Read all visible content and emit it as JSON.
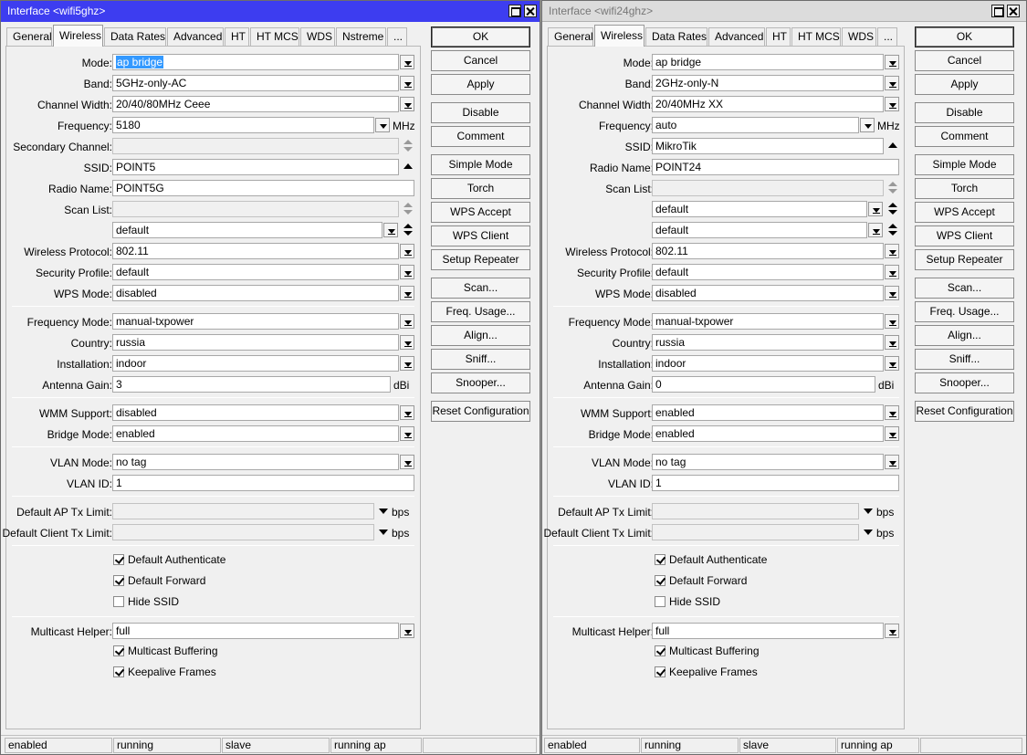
{
  "win1": {
    "title": "Interface <wifi5ghz>",
    "tabs": [
      "General",
      "Wireless",
      "Data Rates",
      "Advanced",
      "HT",
      "HT MCS",
      "WDS",
      "Nstreme",
      "..."
    ],
    "labels": {
      "mode": "Mode:",
      "band": "Band:",
      "channel_width": "Channel Width:",
      "frequency": "Frequency:",
      "secondary_channel": "Secondary Channel:",
      "ssid": "SSID:",
      "radio_name": "Radio Name:",
      "scan_list": "Scan List:",
      "wireless_protocol": "Wireless Protocol:",
      "security_profile": "Security Profile:",
      "wps_mode": "WPS Mode:",
      "frequency_mode": "Frequency Mode:",
      "country": "Country:",
      "installation": "Installation:",
      "antenna_gain": "Antenna Gain:",
      "wmm_support": "WMM Support:",
      "bridge_mode": "Bridge Mode:",
      "vlan_mode": "VLAN Mode:",
      "vlan_id": "VLAN ID:",
      "default_ap_tx_limit": "Default AP Tx Limit:",
      "default_client_tx_limit": "Default Client Tx Limit:",
      "multicast_helper": "Multicast Helper:"
    },
    "values": {
      "mode": "ap bridge",
      "band": "5GHz-only-AC",
      "channel_width": "20/40/80MHz Ceee",
      "frequency": "5180",
      "secondary_channel": "",
      "ssid": "POINT5",
      "radio_name": "POINT5G",
      "scan_list": "",
      "scan_list_2": "default",
      "wireless_protocol": "802.11",
      "security_profile": "default",
      "wps_mode": "disabled",
      "frequency_mode": "manual-txpower",
      "country": "russia",
      "installation": "indoor",
      "antenna_gain": "3",
      "wmm_support": "disabled",
      "bridge_mode": "enabled",
      "vlan_mode": "no tag",
      "vlan_id": "1",
      "default_ap_tx_limit": "",
      "default_client_tx_limit": "",
      "multicast_helper": "full"
    },
    "units": {
      "mhz": "MHz",
      "dbi": "dBi",
      "bps": "bps"
    },
    "checks": {
      "default_authenticate": "Default Authenticate",
      "default_forward": "Default Forward",
      "hide_ssid": "Hide SSID",
      "multicast_buffering": "Multicast Buffering",
      "keepalive_frames": "Keepalive Frames"
    },
    "buttons": [
      "OK",
      "Cancel",
      "Apply",
      "Disable",
      "Comment",
      "Simple Mode",
      "Torch",
      "WPS Accept",
      "WPS Client",
      "Setup Repeater",
      "Scan...",
      "Freq. Usage...",
      "Align...",
      "Sniff...",
      "Snooper...",
      "Reset Configuration"
    ],
    "status": [
      "enabled",
      "running",
      "slave",
      "running ap"
    ]
  },
  "win2": {
    "title": "Interface <wifi24ghz>",
    "tabs": [
      "General",
      "Wireless",
      "Data Rates",
      "Advanced",
      "HT",
      "HT MCS",
      "WDS",
      "..."
    ],
    "labels": {
      "mode": "Mode:",
      "band": "Band:",
      "channel_width": "Channel Width:",
      "frequency": "Frequency:",
      "ssid": "SSID:",
      "radio_name": "Radio Name:",
      "scan_list": "Scan List:",
      "wireless_protocol": "Wireless Protocol:",
      "security_profile": "Security Profile:",
      "wps_mode": "WPS Mode:",
      "frequency_mode": "Frequency Mode:",
      "country": "Country:",
      "installation": "Installation:",
      "antenna_gain": "Antenna Gain:",
      "wmm_support": "WMM Support:",
      "bridge_mode": "Bridge Mode:",
      "vlan_mode": "VLAN Mode:",
      "vlan_id": "VLAN ID:",
      "default_ap_tx_limit": "Default AP Tx Limit:",
      "default_client_tx_limit": "Default Client Tx Limit:",
      "multicast_helper": "Multicast Helper:"
    },
    "values": {
      "mode": "ap bridge",
      "band": "2GHz-only-N",
      "channel_width": "20/40MHz XX",
      "frequency": "auto",
      "ssid": "MikroTik",
      "radio_name": "POINT24",
      "scan_list": "",
      "scan_list_2": "default",
      "scan_list_3": "default",
      "wireless_protocol": "802.11",
      "security_profile": "default",
      "wps_mode": "disabled",
      "frequency_mode": "manual-txpower",
      "country": "russia",
      "installation": "indoor",
      "antenna_gain": "0",
      "wmm_support": "enabled",
      "bridge_mode": "enabled",
      "vlan_mode": "no tag",
      "vlan_id": "1",
      "default_ap_tx_limit": "",
      "default_client_tx_limit": "",
      "multicast_helper": "full"
    },
    "units": {
      "mhz": "MHz",
      "dbi": "dBi",
      "bps": "bps"
    },
    "checks": {
      "default_authenticate": "Default Authenticate",
      "default_forward": "Default Forward",
      "hide_ssid": "Hide SSID",
      "multicast_buffering": "Multicast Buffering",
      "keepalive_frames": "Keepalive Frames"
    },
    "buttons": [
      "OK",
      "Cancel",
      "Apply",
      "Disable",
      "Comment",
      "Simple Mode",
      "Torch",
      "WPS Accept",
      "WPS Client",
      "Setup Repeater",
      "Scan...",
      "Freq. Usage...",
      "Align...",
      "Sniff...",
      "Snooper...",
      "Reset Configuration"
    ],
    "status": [
      "enabled",
      "running",
      "slave",
      "running ap"
    ]
  }
}
